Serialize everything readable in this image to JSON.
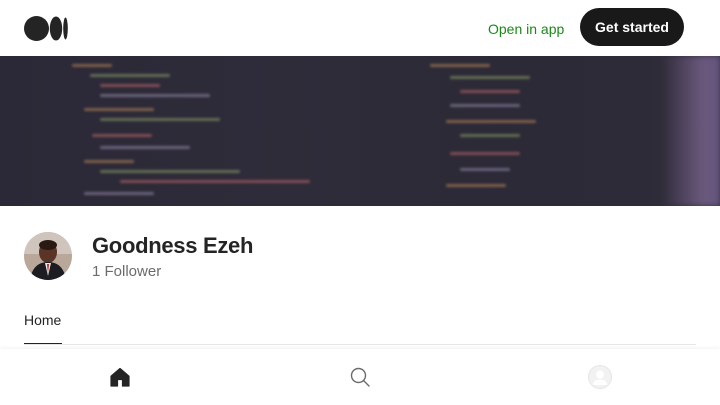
{
  "header": {
    "logo_icon": "medium-logo-icon",
    "open_in_app_label": "Open in app",
    "get_started_label": "Get started"
  },
  "profile": {
    "name": "Goodness Ezeh",
    "followers_label": "1 Follower",
    "avatar_icon": "avatar-photo"
  },
  "tabs": [
    {
      "label": "Home",
      "active": true
    }
  ],
  "bottom_nav": [
    {
      "icon": "home-icon",
      "active": true
    },
    {
      "icon": "search-icon",
      "active": false
    },
    {
      "icon": "profile-icon",
      "active": false
    }
  ],
  "colors": {
    "accent_green": "#1a8917",
    "primary_button": "#191919",
    "text_primary": "#242424",
    "text_secondary": "#6b6b6b",
    "banner_bg": "#2d2b37"
  }
}
